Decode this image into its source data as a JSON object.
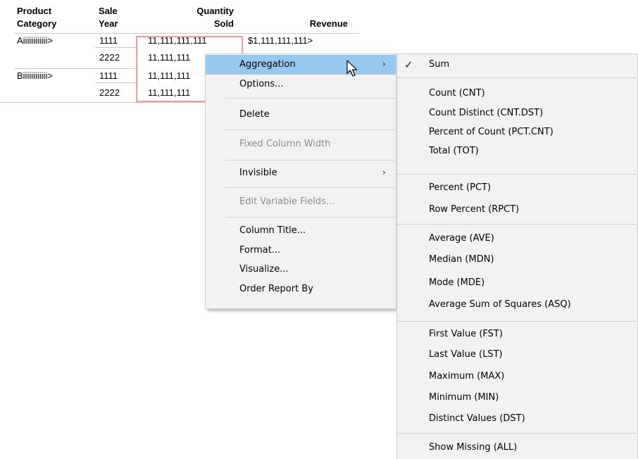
{
  "report": {
    "headers": {
      "product_category": [
        "Product",
        "Category"
      ],
      "sale_year": [
        "Sale",
        "Year"
      ],
      "quantity_sold": [
        "Quantity",
        "Sold"
      ],
      "revenue": "Revenue"
    },
    "rows": [
      {
        "category": "Aiiiiiiiiiiii>",
        "year": "1111",
        "qty": "11,111,111,111",
        "revenue": "$1,111,111,111>"
      },
      {
        "category": "",
        "year": "2222",
        "qty": "11,111,111",
        "revenue": ""
      },
      {
        "category": "Biiiiiiiiiiii>",
        "year": "1111",
        "qty": "11,111,111",
        "revenue": ""
      },
      {
        "category": "",
        "year": "2222",
        "qty": "11,111,111",
        "revenue": ""
      }
    ]
  },
  "context_menu": {
    "items": [
      {
        "label": "Aggregation",
        "submenu": true,
        "highlighted": true
      },
      {
        "label": "Options..."
      },
      {
        "label": "Delete"
      },
      {
        "label": "Fixed Column Width",
        "disabled": true
      },
      {
        "label": "Invisible",
        "submenu": true
      },
      {
        "label": "Edit Variable Fields...",
        "disabled": true
      },
      {
        "label": "Column Title..."
      },
      {
        "label": "Format..."
      },
      {
        "label": "Visualize..."
      },
      {
        "label": "Order Report By"
      }
    ],
    "submenu_arrow": "›"
  },
  "aggregation_menu": {
    "check_mark": "✓",
    "items": [
      {
        "label": "Sum",
        "checked": true
      },
      {
        "label": "Count (CNT)"
      },
      {
        "label": "Count Distinct (CNT.DST)"
      },
      {
        "label": "Percent of Count (PCT.CNT)"
      },
      {
        "label": "Total (TOT)"
      },
      {
        "label": "Percent (PCT)"
      },
      {
        "label": "Row Percent (RPCT)"
      },
      {
        "label": "Average (AVE)"
      },
      {
        "label": "Median (MDN)"
      },
      {
        "label": "Mode (MDE)"
      },
      {
        "label": "Average Sum of Squares (ASQ)"
      },
      {
        "label": "First Value (FST)"
      },
      {
        "label": "Last Value (LST)"
      },
      {
        "label": "Maximum (MAX)"
      },
      {
        "label": "Minimum (MIN)"
      },
      {
        "label": "Distinct Values (DST)"
      },
      {
        "label": "Show Missing (ALL)"
      }
    ]
  },
  "colors": {
    "highlight": "#96c8f0",
    "selection_border": "#f29c9c",
    "menu_bg": "#f2f2f2"
  },
  "icons": {
    "cursor": "arrow-pointer-icon"
  }
}
